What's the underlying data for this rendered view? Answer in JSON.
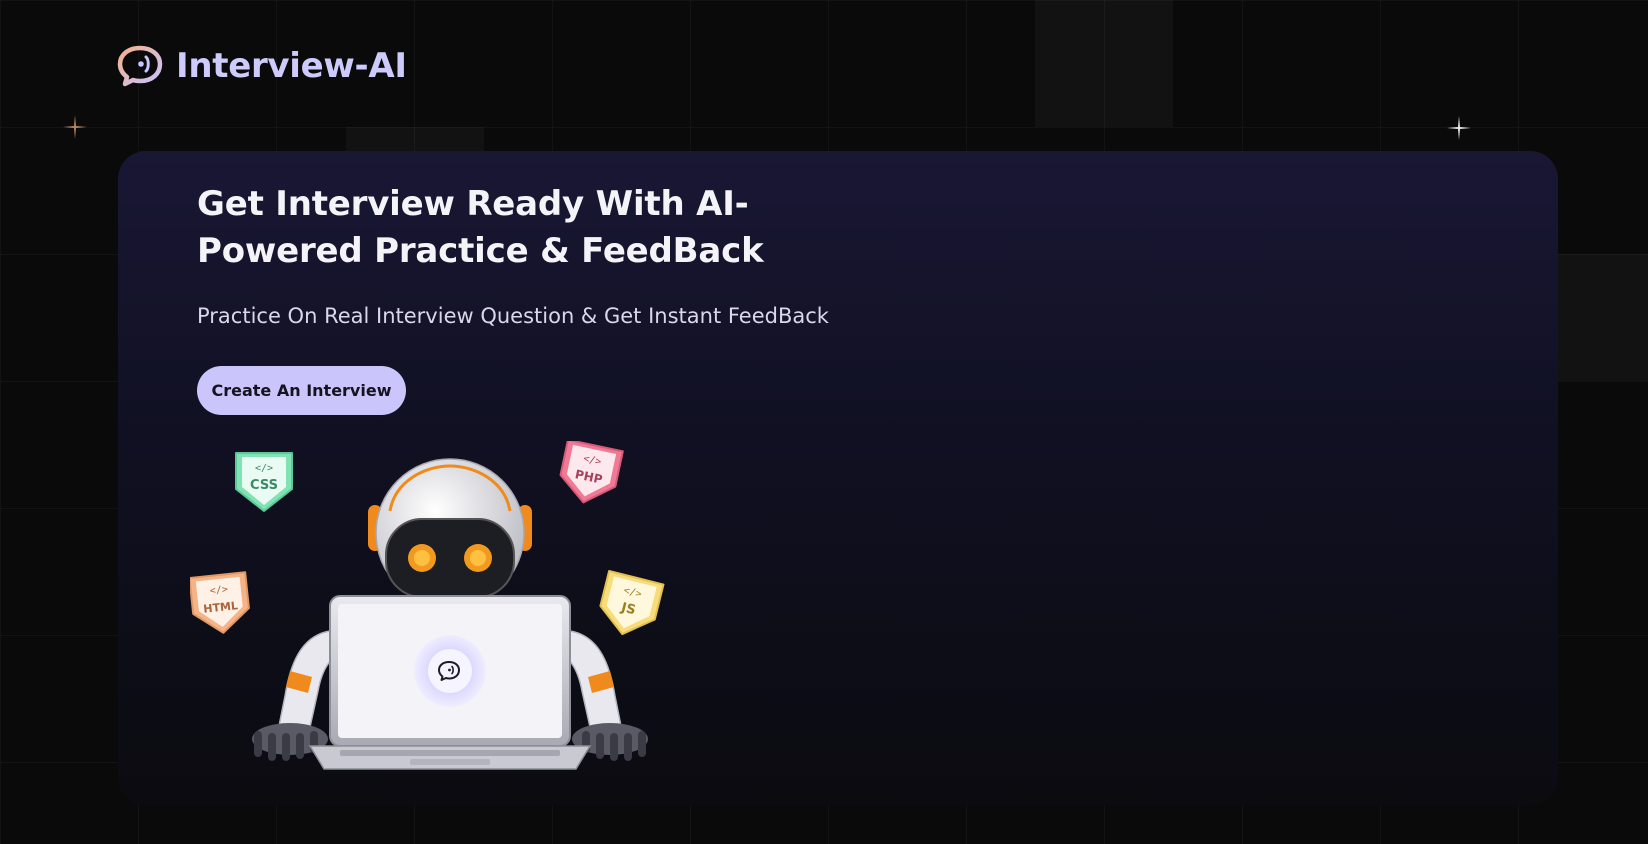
{
  "brand": {
    "name": "Interview-AI",
    "logo_icon": "chat-bubble-voice-icon",
    "logo_gradient": [
      "#f6b08c",
      "#c7c4ff"
    ]
  },
  "hero": {
    "title": "Get Interview Ready With AI-Powered Practice & FeedBack",
    "subtitle": "Practice On Real Interview Question & Get Instant FeedBack",
    "cta_label": "Create An Interview"
  },
  "illustration": {
    "subject": "robot-with-laptop",
    "badges": [
      {
        "label": "CSS",
        "icon": "code-icon",
        "color": "#7fe3b4"
      },
      {
        "label": "PHP",
        "icon": "code-icon",
        "color": "#f07a96"
      },
      {
        "label": "HTML",
        "icon": "code-icon",
        "color": "#f5b488"
      },
      {
        "label": "JS",
        "icon": "code-icon",
        "color": "#f8dc7a"
      }
    ]
  },
  "colors": {
    "background": "#0a0a0b",
    "card_top": "#191734",
    "card_bottom": "#0b0b10",
    "accent": "#cac5fb",
    "robot_orange": "#f08a1c"
  }
}
